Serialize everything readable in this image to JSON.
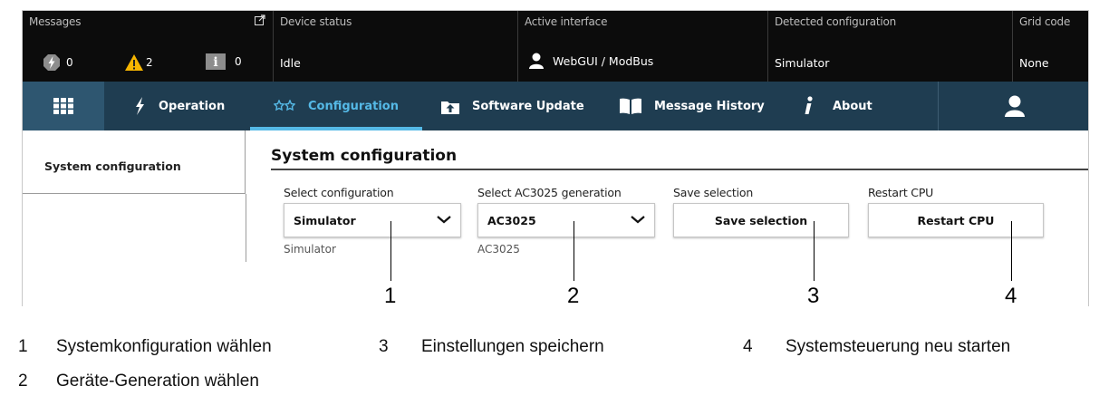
{
  "statusbar": {
    "messages": {
      "title": "Messages",
      "counts": [
        {
          "icon": "bolt-error-icon",
          "value": "0"
        },
        {
          "icon": "warning-icon",
          "value": "2"
        },
        {
          "icon": "info-icon",
          "value": "0"
        }
      ]
    },
    "device_status": {
      "title": "Device status",
      "value": "Idle"
    },
    "active_interface": {
      "title": "Active interface",
      "value": "WebGUI / ModBus"
    },
    "detected_configuration": {
      "title": "Detected configuration",
      "value": "Simulator"
    },
    "grid_code": {
      "title": "Grid code",
      "value": "None"
    }
  },
  "nav": {
    "items": [
      {
        "label": "Operation",
        "icon": "bolt-icon"
      },
      {
        "label": "Configuration",
        "icon": "configuration-icon"
      },
      {
        "label": "Software Update",
        "icon": "upload-icon"
      },
      {
        "label": "Message History",
        "icon": "book-icon"
      },
      {
        "label": "About",
        "icon": "info-italic-icon"
      }
    ],
    "active": "Configuration"
  },
  "sidebar": {
    "items": [
      {
        "label": "System configuration"
      }
    ]
  },
  "main": {
    "title": "System configuration",
    "select_configuration": {
      "label": "Select configuration",
      "value": "Simulator",
      "sub": "Simulator"
    },
    "select_generation": {
      "label": "Select AC3025 generation",
      "value": "AC3025",
      "sub": "AC3025"
    },
    "save": {
      "label": "Save selection",
      "button": "Save selection"
    },
    "restart": {
      "label": "Restart CPU",
      "button": "Restart CPU"
    }
  },
  "callouts": [
    "1",
    "2",
    "3",
    "4"
  ],
  "legend": [
    {
      "num": "1",
      "text": "Systemkonfiguration wählen"
    },
    {
      "num": "3",
      "text": "Einstellungen speichern"
    },
    {
      "num": "4",
      "text": "Systemsteuerung neu starten"
    },
    {
      "num": "2",
      "text": "Geräte-Generation wählen"
    }
  ],
  "colors": {
    "nav_bg": "#1f3d51",
    "accent": "#55b9e6",
    "status_bg": "#0c0c0c",
    "warning": "#f6b500"
  }
}
